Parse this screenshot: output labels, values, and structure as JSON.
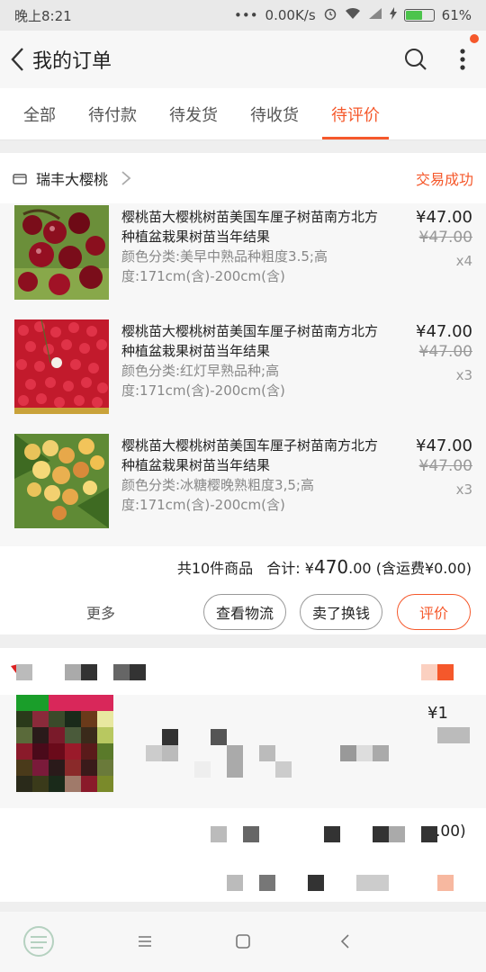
{
  "status_bar": {
    "time": "晚上8:21",
    "network_speed": "0.00K/s",
    "battery_percent": "61%",
    "battery_level": 0.61
  },
  "header": {
    "title": "我的订单",
    "has_notification": true
  },
  "tabs": [
    {
      "label": "全部",
      "active": false
    },
    {
      "label": "待付款",
      "active": false
    },
    {
      "label": "待发货",
      "active": false
    },
    {
      "label": "待收货",
      "active": false
    },
    {
      "label": "待评价",
      "active": true
    }
  ],
  "order": {
    "shop_name": "瑞丰大樱桃",
    "status": "交易成功",
    "items": [
      {
        "title": "樱桃苗大樱桃树苗美国车厘子树苗南方北方种植盆栽果树苗当年结果",
        "spec": "颜色分类:美早中熟品种粗度3.5;高度:171cm(含)-200cm(含)",
        "price": "¥47.00",
        "original_price": "¥47.00",
        "quantity": "x4"
      },
      {
        "title": "樱桃苗大樱桃树苗美国车厘子树苗南方北方种植盆栽果树苗当年结果",
        "spec": "颜色分类:红灯早熟品种;高度:171cm(含)-200cm(含)",
        "price": "¥47.00",
        "original_price": "¥47.00",
        "quantity": "x3"
      },
      {
        "title": "樱桃苗大樱桃树苗美国车厘子树苗南方北方种植盆栽果树苗当年结果",
        "spec": "颜色分类:冰糖樱晚熟粗度3,5;高度:171cm(含)-200cm(含)",
        "price": "¥47.00",
        "original_price": "¥47.00",
        "quantity": "x3"
      }
    ],
    "summary_count": "共10件商品",
    "summary_total_label": "合计:",
    "summary_currency": "¥",
    "summary_total": "470",
    "summary_decimals": ".00",
    "summary_shipping": "(含运费¥0.00)",
    "more_label": "更多",
    "buttons": {
      "logistics": "查看物流",
      "resell": "卖了换钱",
      "review": "评价"
    }
  },
  "second_order_partial": {
    "price_partial": "¥1",
    "total_partial": ".00)"
  },
  "colors": {
    "accent": "#f5582b",
    "background": "#efefef"
  }
}
